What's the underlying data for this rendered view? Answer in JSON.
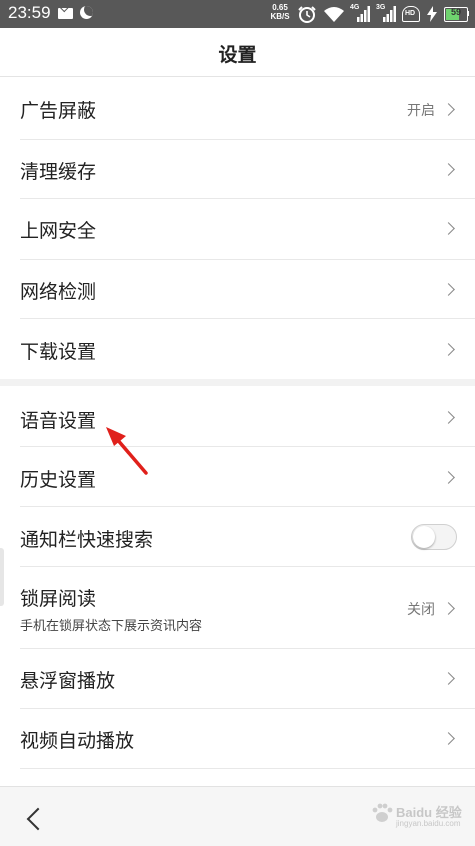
{
  "status_bar": {
    "time": "23:59",
    "net_speed_value": "0.65",
    "net_speed_unit": "KB/S",
    "battery_level": "59",
    "battery_fraction": 0.59,
    "signal_1_label": "4G",
    "signal_2_label": "3G",
    "hd_label": "HD",
    "icons": [
      "mail-icon",
      "moon-icon",
      "alarm-icon",
      "wifi-icon",
      "signal-4g-icon",
      "signal-3g-icon",
      "hd-icon",
      "charging-icon",
      "battery-icon"
    ]
  },
  "header": {
    "title": "设置"
  },
  "settings": {
    "ad_block": {
      "label": "广告屏蔽",
      "value": "开启"
    },
    "clear_cache": {
      "label": "清理缓存"
    },
    "web_security": {
      "label": "上网安全"
    },
    "network_check": {
      "label": "网络检测"
    },
    "download_settings": {
      "label": "下载设置"
    },
    "voice_settings": {
      "label": "语音设置"
    },
    "history_settings": {
      "label": "历史设置"
    },
    "notification_search": {
      "label": "通知栏快速搜索",
      "enabled": false
    },
    "lockscreen_reading": {
      "label": "锁屏阅读",
      "subtitle": "手机在锁屏状态下展示资讯内容",
      "value": "关闭"
    },
    "floating_window": {
      "label": "悬浮窗播放"
    },
    "video_autoplay": {
      "label": "视频自动播放"
    }
  },
  "nav": {
    "back_icon": "back-chevron-icon"
  },
  "watermark": {
    "text": "Baidu 经验",
    "sub": "jingyan.baidu.com"
  },
  "colors": {
    "status_bar_bg": "#585858",
    "annotation_arrow": "#e0201b",
    "section_gap": "#f2f2f2"
  }
}
